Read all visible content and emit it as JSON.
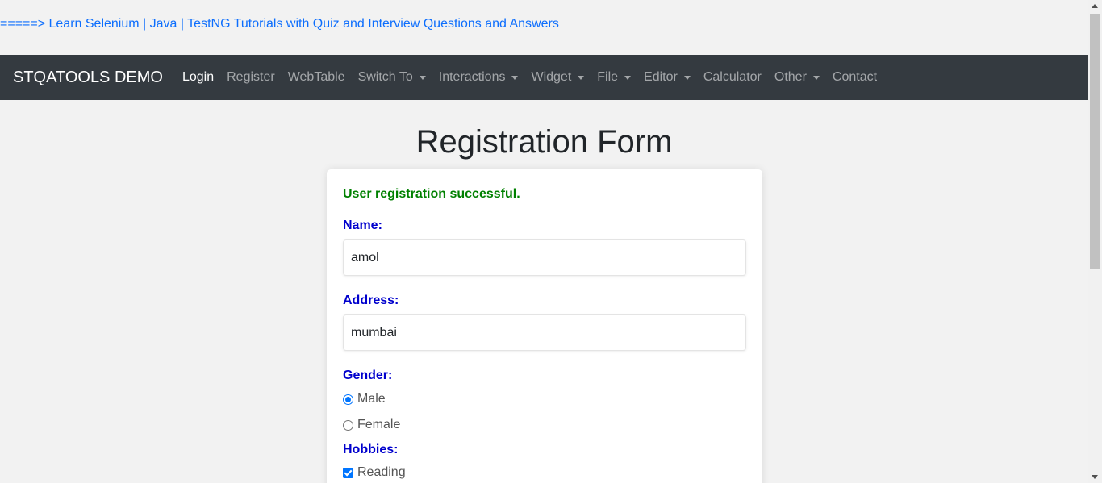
{
  "top_link": "=====> Learn Selenium | Java | TestNG Tutorials with Quiz and Interview Questions and Answers",
  "navbar": {
    "brand": "STQATOOLS DEMO",
    "items": [
      {
        "label": "Login",
        "dropdown": false,
        "active": true
      },
      {
        "label": "Register",
        "dropdown": false
      },
      {
        "label": "WebTable",
        "dropdown": false
      },
      {
        "label": "Switch To",
        "dropdown": true
      },
      {
        "label": "Interactions",
        "dropdown": true
      },
      {
        "label": "Widget",
        "dropdown": true
      },
      {
        "label": "File",
        "dropdown": true
      },
      {
        "label": "Editor",
        "dropdown": true
      },
      {
        "label": "Calculator",
        "dropdown": false
      },
      {
        "label": "Other",
        "dropdown": true
      },
      {
        "label": "Contact",
        "dropdown": false
      }
    ]
  },
  "page": {
    "title": "Registration Form"
  },
  "form": {
    "success_message": "User registration successful.",
    "name_label": "Name:",
    "name_value": "amol",
    "address_label": "Address:",
    "address_value": "mumbai",
    "gender_label": "Gender:",
    "gender_options": [
      {
        "label": "Male",
        "checked": true
      },
      {
        "label": "Female",
        "checked": false
      }
    ],
    "hobbies_label": "Hobbies:",
    "hobbies_options": [
      {
        "label": "Reading",
        "checked": true
      }
    ]
  },
  "colors": {
    "navbar_bg": "#343a40",
    "link": "#0d6efd",
    "label": "#0000cd",
    "success": "#008000",
    "accent": "#0075ff"
  }
}
